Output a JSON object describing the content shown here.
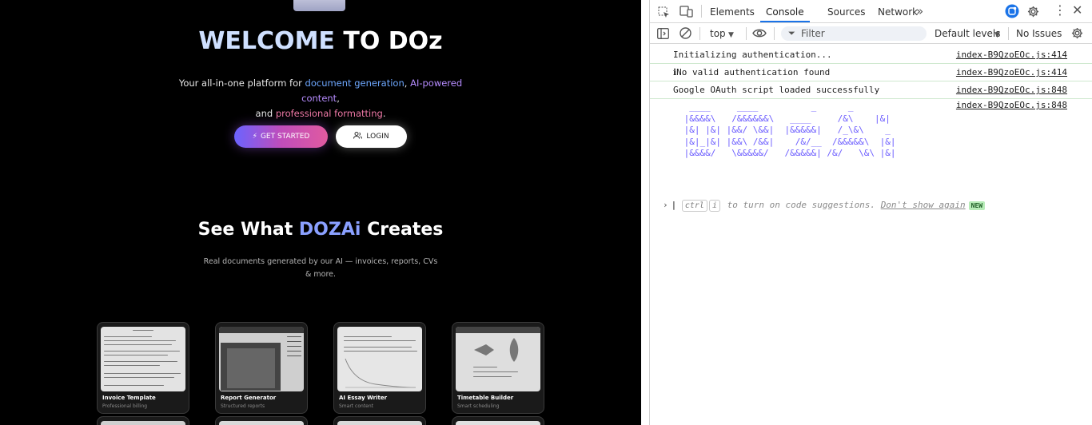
{
  "site": {
    "hero": {
      "title_highlight": "WELCOME",
      "title_rest": " TO DOz",
      "sub_intro": "Your all-in-one platform for ",
      "sub_doc": "document generation",
      "sub_comma": ", ",
      "sub_ai": "AI-powered content",
      "sub_and": ",\nand ",
      "sub_prof": "professional formatting",
      "sub_end": "."
    },
    "buttons": {
      "get_started": "GET STARTED",
      "login": "LOGIN"
    },
    "section": {
      "title_pre": "See What ",
      "title_brand": "DOZAi",
      "title_post": " Creates",
      "subtitle": "Real documents generated by our AI — invoices, reports, CVs & more."
    },
    "cards": [
      {
        "title": "Invoice Template",
        "subtitle": "Professional billing"
      },
      {
        "title": "Report Generator",
        "subtitle": "Structured reports"
      },
      {
        "title": "AI Essay Writer",
        "subtitle": "Smart content"
      },
      {
        "title": "Timetable Builder",
        "subtitle": "Smart scheduling"
      }
    ]
  },
  "devtools": {
    "tabs": [
      "Elements",
      "Console",
      "Sources",
      "Network"
    ],
    "active_tab": "Console",
    "toolbar": {
      "context": "top",
      "filter_placeholder": "Filter",
      "levels": "Default levels",
      "issues": "No Issues"
    },
    "messages": [
      {
        "text": "Initializing authentication...",
        "source": "index-B9QzoEOc.js:414"
      },
      {
        "text": "ℹNo valid authentication found",
        "source": "index-B9QzoEOc.js:414"
      },
      {
        "text": "Google OAuth script loaded successfully",
        "source": "index-B9QzoEOc.js:848"
      },
      {
        "text": "",
        "source": "index-B9QzoEOc.js:848"
      }
    ],
    "ascii_art": "  ____     ____          _      _ \n |&&&&\\   /&&&&&&\\   ____     /&\\    |&|\n |&| |&| |&&/ \\&&|  |&&&&&|   /_\\&\\    _ \n |&|_|&| |&&\\ /&&|    /&/__  /&&&&&\\  |&|\n |&&&&/   \\&&&&&/   /&&&&&| /&/   \\&\\ |&|",
    "prompt": {
      "key1": "ctrl",
      "key2": "i",
      "text": " to turn on code suggestions. ",
      "dismiss": "Don't show again",
      "badge": "NEW"
    }
  },
  "colors": {
    "accent": "#1a73e8",
    "brand": "#8aa0ff",
    "ascii": "#6b5cff"
  }
}
